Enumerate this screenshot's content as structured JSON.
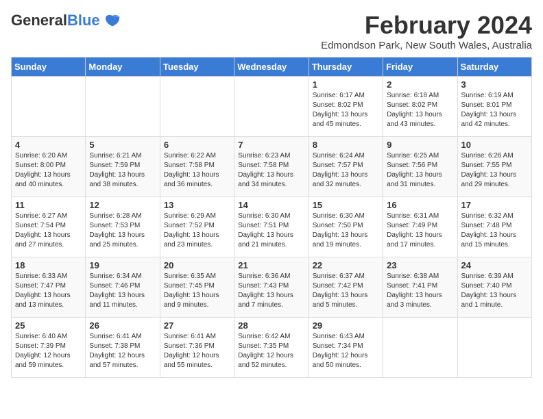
{
  "logo": {
    "general": "General",
    "blue": "Blue"
  },
  "title": "February 2024",
  "subtitle": "Edmondson Park, New South Wales, Australia",
  "days_header": [
    "Sunday",
    "Monday",
    "Tuesday",
    "Wednesday",
    "Thursday",
    "Friday",
    "Saturday"
  ],
  "weeks": [
    [
      {
        "day": "",
        "info": ""
      },
      {
        "day": "",
        "info": ""
      },
      {
        "day": "",
        "info": ""
      },
      {
        "day": "",
        "info": ""
      },
      {
        "day": "1",
        "info": "Sunrise: 6:17 AM\nSunset: 8:02 PM\nDaylight: 13 hours and 45 minutes."
      },
      {
        "day": "2",
        "info": "Sunrise: 6:18 AM\nSunset: 8:02 PM\nDaylight: 13 hours and 43 minutes."
      },
      {
        "day": "3",
        "info": "Sunrise: 6:19 AM\nSunset: 8:01 PM\nDaylight: 13 hours and 42 minutes."
      }
    ],
    [
      {
        "day": "4",
        "info": "Sunrise: 6:20 AM\nSunset: 8:00 PM\nDaylight: 13 hours and 40 minutes."
      },
      {
        "day": "5",
        "info": "Sunrise: 6:21 AM\nSunset: 7:59 PM\nDaylight: 13 hours and 38 minutes."
      },
      {
        "day": "6",
        "info": "Sunrise: 6:22 AM\nSunset: 7:58 PM\nDaylight: 13 hours and 36 minutes."
      },
      {
        "day": "7",
        "info": "Sunrise: 6:23 AM\nSunset: 7:58 PM\nDaylight: 13 hours and 34 minutes."
      },
      {
        "day": "8",
        "info": "Sunrise: 6:24 AM\nSunset: 7:57 PM\nDaylight: 13 hours and 32 minutes."
      },
      {
        "day": "9",
        "info": "Sunrise: 6:25 AM\nSunset: 7:56 PM\nDaylight: 13 hours and 31 minutes."
      },
      {
        "day": "10",
        "info": "Sunrise: 6:26 AM\nSunset: 7:55 PM\nDaylight: 13 hours and 29 minutes."
      }
    ],
    [
      {
        "day": "11",
        "info": "Sunrise: 6:27 AM\nSunset: 7:54 PM\nDaylight: 13 hours and 27 minutes."
      },
      {
        "day": "12",
        "info": "Sunrise: 6:28 AM\nSunset: 7:53 PM\nDaylight: 13 hours and 25 minutes."
      },
      {
        "day": "13",
        "info": "Sunrise: 6:29 AM\nSunset: 7:52 PM\nDaylight: 13 hours and 23 minutes."
      },
      {
        "day": "14",
        "info": "Sunrise: 6:30 AM\nSunset: 7:51 PM\nDaylight: 13 hours and 21 minutes."
      },
      {
        "day": "15",
        "info": "Sunrise: 6:30 AM\nSunset: 7:50 PM\nDaylight: 13 hours and 19 minutes."
      },
      {
        "day": "16",
        "info": "Sunrise: 6:31 AM\nSunset: 7:49 PM\nDaylight: 13 hours and 17 minutes."
      },
      {
        "day": "17",
        "info": "Sunrise: 6:32 AM\nSunset: 7:48 PM\nDaylight: 13 hours and 15 minutes."
      }
    ],
    [
      {
        "day": "18",
        "info": "Sunrise: 6:33 AM\nSunset: 7:47 PM\nDaylight: 13 hours and 13 minutes."
      },
      {
        "day": "19",
        "info": "Sunrise: 6:34 AM\nSunset: 7:46 PM\nDaylight: 13 hours and 11 minutes."
      },
      {
        "day": "20",
        "info": "Sunrise: 6:35 AM\nSunset: 7:45 PM\nDaylight: 13 hours and 9 minutes."
      },
      {
        "day": "21",
        "info": "Sunrise: 6:36 AM\nSunset: 7:43 PM\nDaylight: 13 hours and 7 minutes."
      },
      {
        "day": "22",
        "info": "Sunrise: 6:37 AM\nSunset: 7:42 PM\nDaylight: 13 hours and 5 minutes."
      },
      {
        "day": "23",
        "info": "Sunrise: 6:38 AM\nSunset: 7:41 PM\nDaylight: 13 hours and 3 minutes."
      },
      {
        "day": "24",
        "info": "Sunrise: 6:39 AM\nSunset: 7:40 PM\nDaylight: 13 hours and 1 minute."
      }
    ],
    [
      {
        "day": "25",
        "info": "Sunrise: 6:40 AM\nSunset: 7:39 PM\nDaylight: 12 hours and 59 minutes."
      },
      {
        "day": "26",
        "info": "Sunrise: 6:41 AM\nSunset: 7:38 PM\nDaylight: 12 hours and 57 minutes."
      },
      {
        "day": "27",
        "info": "Sunrise: 6:41 AM\nSunset: 7:36 PM\nDaylight: 12 hours and 55 minutes."
      },
      {
        "day": "28",
        "info": "Sunrise: 6:42 AM\nSunset: 7:35 PM\nDaylight: 12 hours and 52 minutes."
      },
      {
        "day": "29",
        "info": "Sunrise: 6:43 AM\nSunset: 7:34 PM\nDaylight: 12 hours and 50 minutes."
      },
      {
        "day": "",
        "info": ""
      },
      {
        "day": "",
        "info": ""
      }
    ]
  ]
}
